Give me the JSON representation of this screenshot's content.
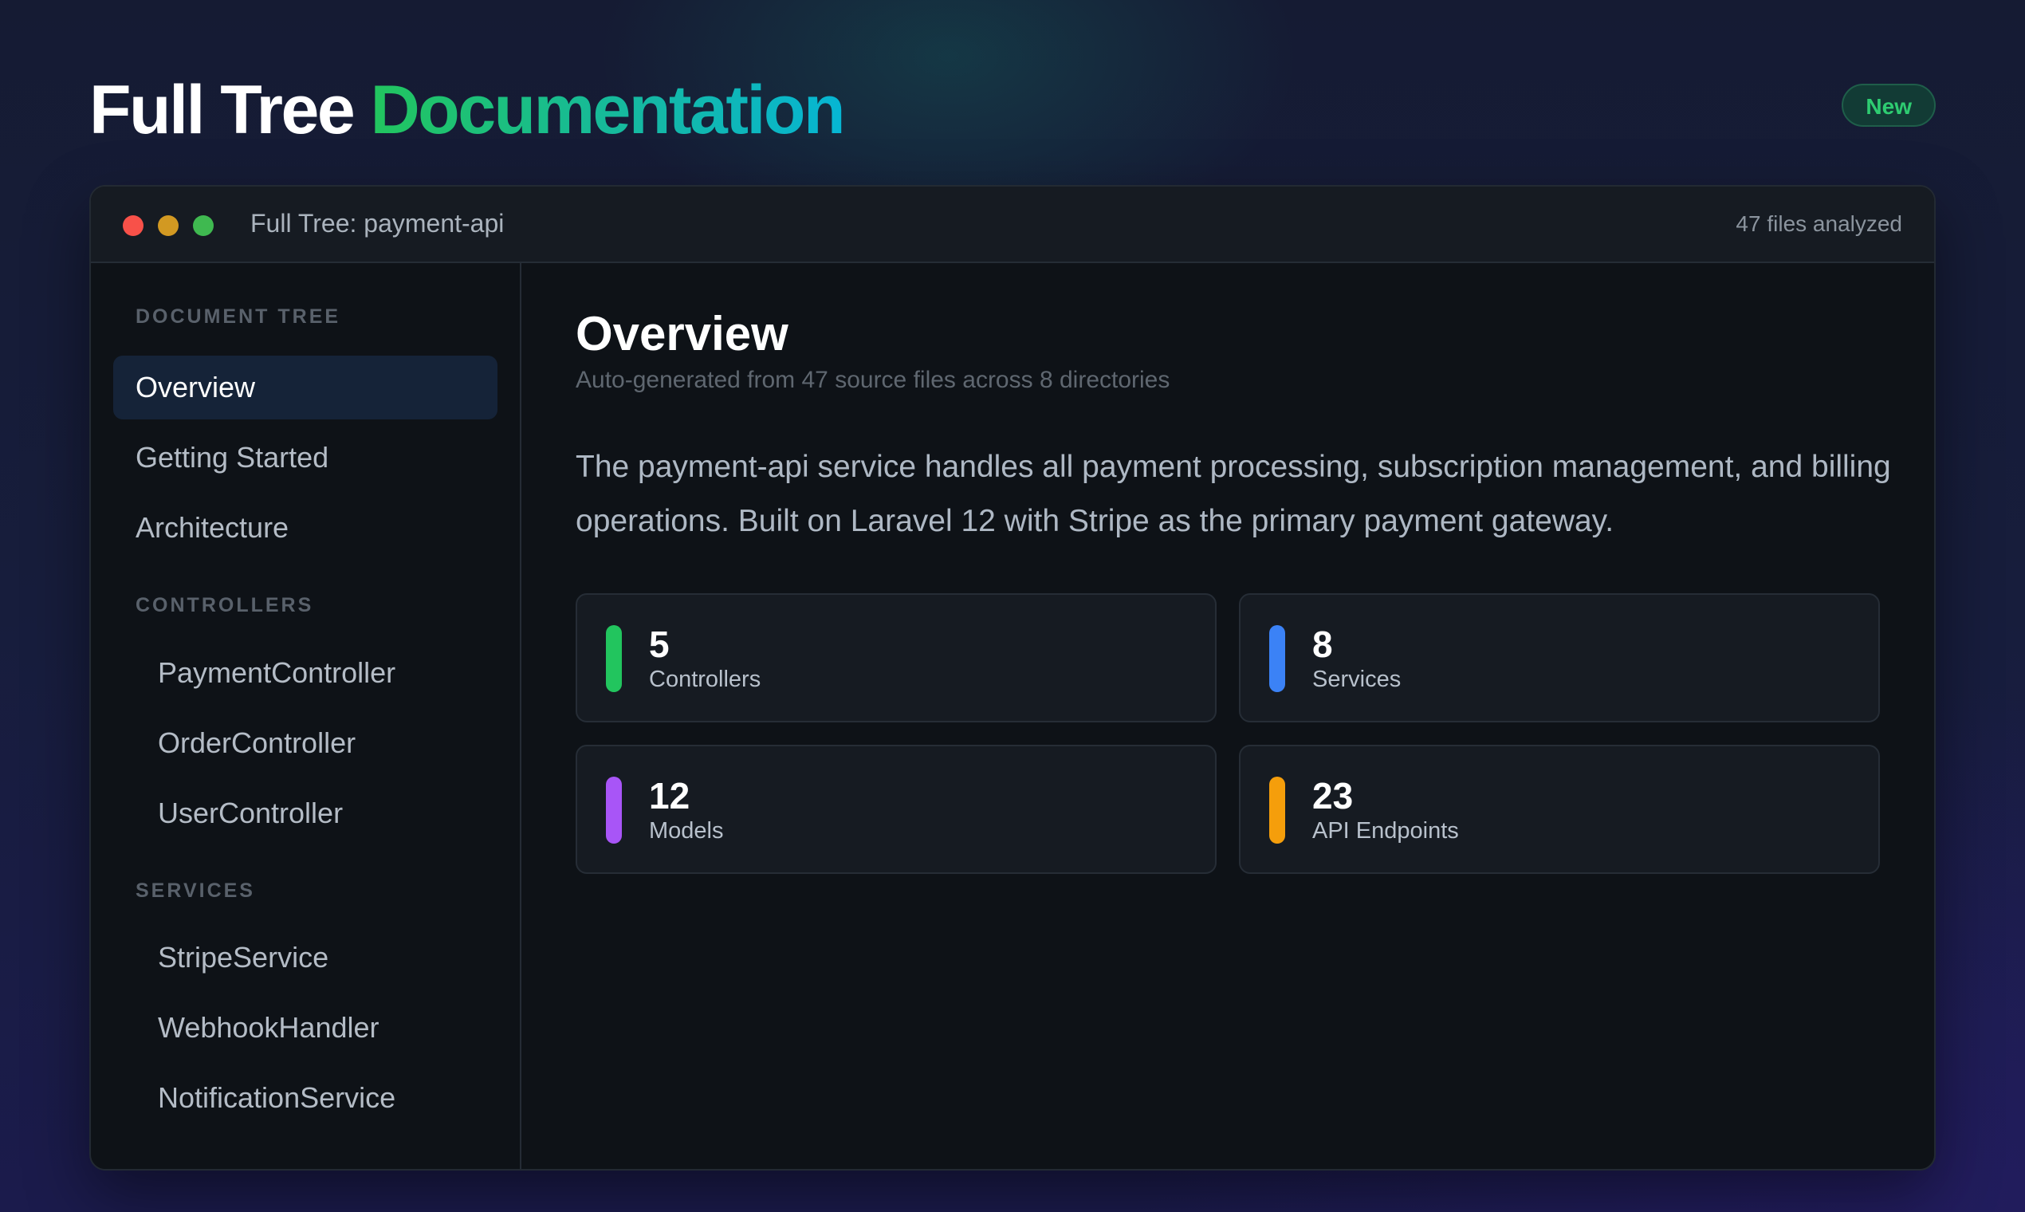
{
  "header": {
    "title_main": "Full Tree",
    "title_accent": "Documentation",
    "badge": "New"
  },
  "window": {
    "title": "Full Tree: payment-api",
    "files_analyzed": "47 files analyzed"
  },
  "sidebar": {
    "sections": [
      {
        "label": "DOCUMENT TREE",
        "items": [
          {
            "label": "Overview",
            "active": true
          },
          {
            "label": "Getting Started"
          },
          {
            "label": "Architecture"
          }
        ]
      },
      {
        "label": "CONTROLLERS",
        "items": [
          {
            "label": "PaymentController"
          },
          {
            "label": "OrderController"
          },
          {
            "label": "UserController"
          }
        ]
      },
      {
        "label": "SERVICES",
        "items": [
          {
            "label": "StripeService"
          },
          {
            "label": "WebhookHandler"
          },
          {
            "label": "NotificationService"
          }
        ]
      }
    ]
  },
  "main": {
    "title": "Overview",
    "subtitle": "Auto-generated from 47 source files across 8 directories",
    "description": "The payment-api service handles all payment processing, subscription management, and billing operations. Built on Laravel 12 with Stripe as the primary payment gateway.",
    "stats": [
      {
        "value": "5",
        "label": "Controllers",
        "color": "#22c55e"
      },
      {
        "value": "8",
        "label": "Services",
        "color": "#3b82f6"
      },
      {
        "value": "12",
        "label": "Models",
        "color": "#a855f7"
      },
      {
        "value": "23",
        "label": "API Endpoints",
        "color": "#f59e0b"
      }
    ]
  },
  "colors": {
    "accent_green": "#22c55e",
    "accent_teal": "#14b8a6",
    "traffic_red": "#f85149",
    "traffic_yellow": "#d29922",
    "traffic_green": "#3fb950"
  }
}
